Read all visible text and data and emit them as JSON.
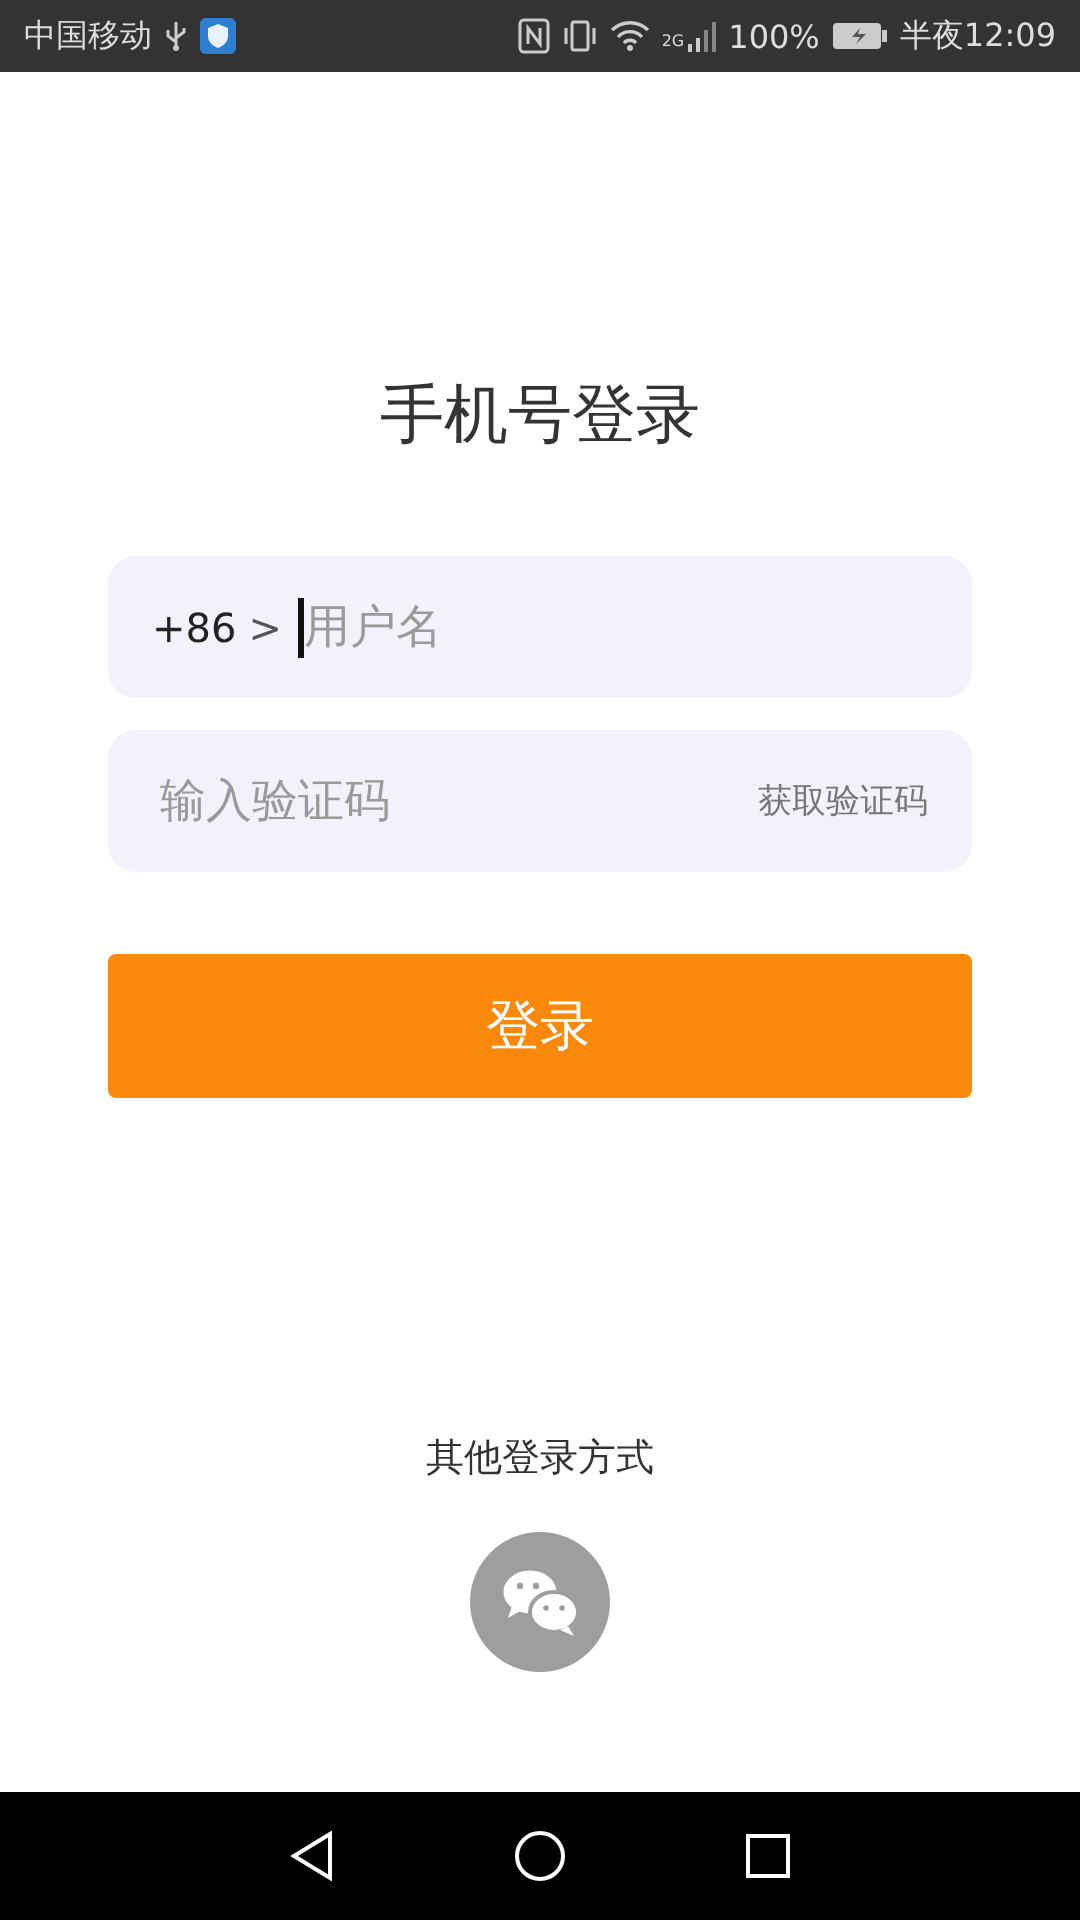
{
  "status_bar": {
    "carrier": "中国移动",
    "network": "2G",
    "battery": "100%",
    "time": "半夜12:09"
  },
  "title": "手机号登录",
  "phone_field": {
    "country_code": "+86",
    "chevron": ">",
    "placeholder": "用户名"
  },
  "code_field": {
    "placeholder": "输入验证码",
    "action": "获取验证码"
  },
  "login_button": "登录",
  "other_login": {
    "label": "其他登录方式"
  }
}
